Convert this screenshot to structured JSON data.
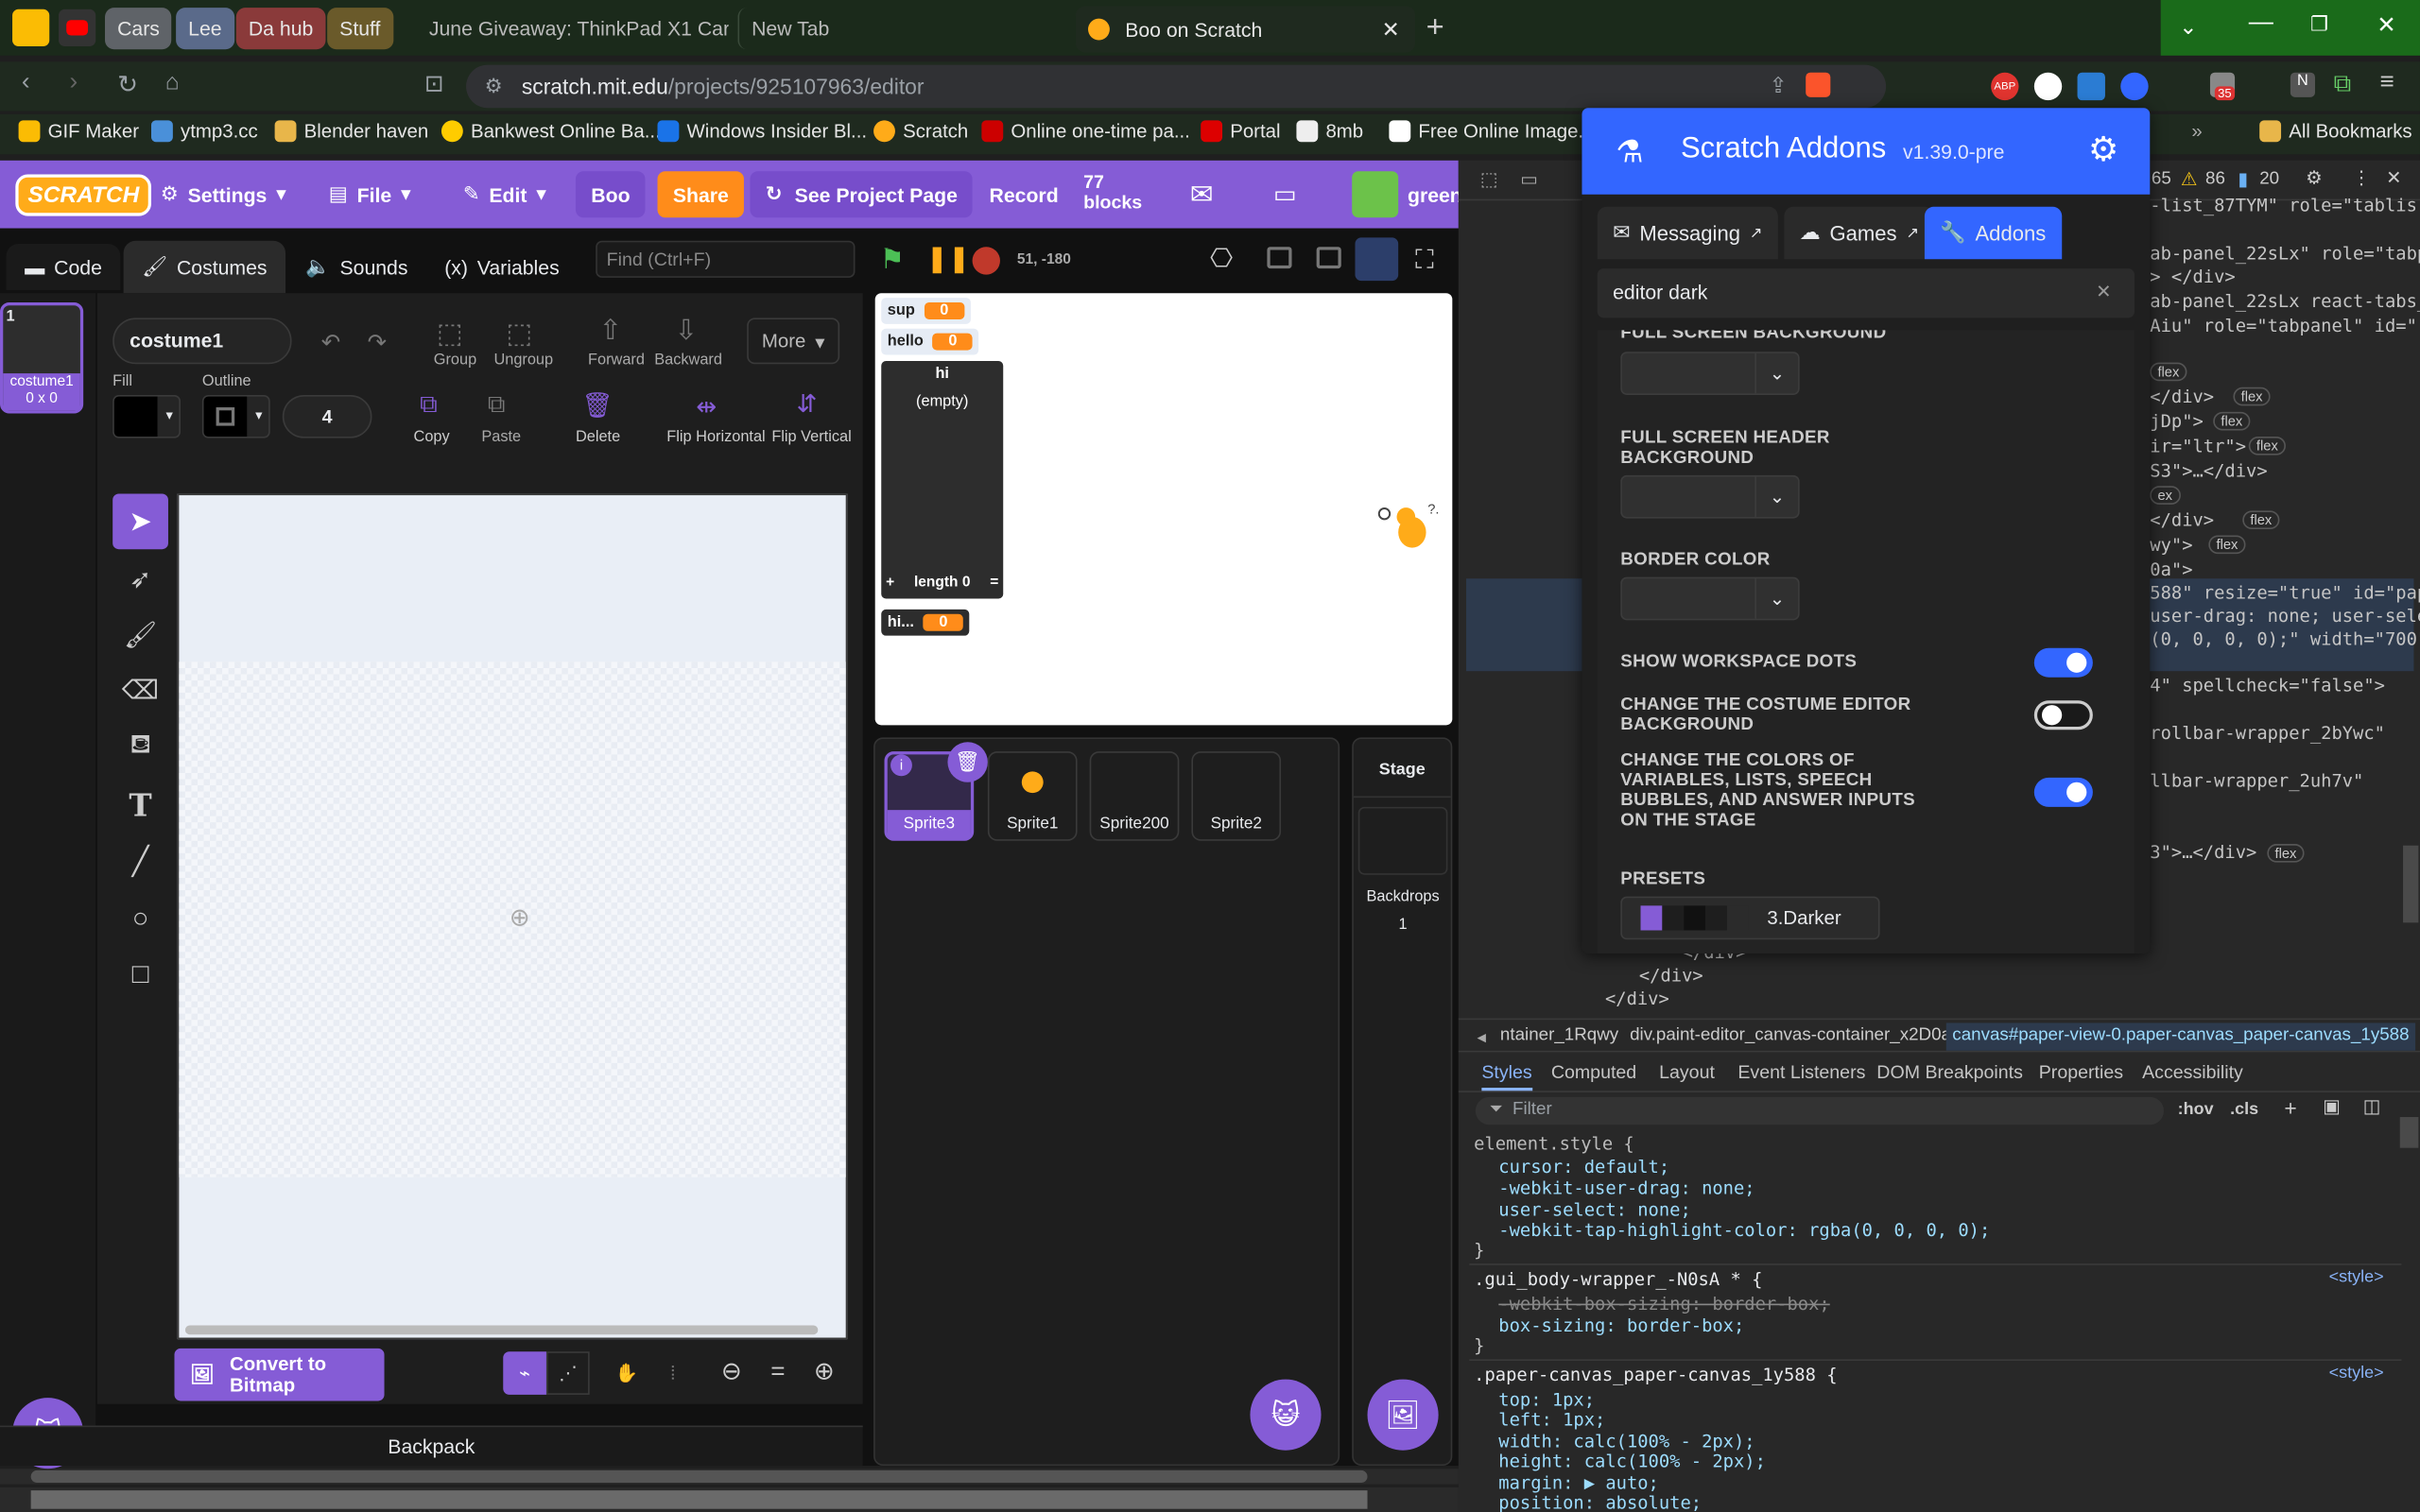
{
  "browser": {
    "tab_groups": [
      "Cars",
      "Lee",
      "Da hub",
      "Stuff"
    ],
    "tabs": [
      {
        "title": "June Giveaway: ThinkPad X1 Carbon"
      },
      {
        "title": "New Tab"
      },
      {
        "title": "Boo on Scratch"
      }
    ],
    "url_host": "scratch.mit.edu",
    "url_path": "/projects/925107963/editor",
    "bookmarks": [
      "GIF Maker",
      "ytmp3.cc",
      "Blender haven",
      "Bankwest Online Ba...",
      "Windows Insider Bl...",
      "Scratch",
      "Online one-time pa...",
      "Portal",
      "8mb",
      "Free Online Image..."
    ],
    "all_bookmarks": "All Bookmarks",
    "ext_badge": "35"
  },
  "scratch": {
    "logo": "SCRATCH",
    "menu": {
      "settings": "Settings",
      "file": "File",
      "edit": "Edit",
      "title": "Boo",
      "share": "Share",
      "see_project_page": "See Project Page",
      "record": "Record",
      "block_count": "77",
      "blocks_word": "blocks",
      "username": "greeny-"
    },
    "tabs": {
      "code": "Code",
      "costumes": "Costumes",
      "sounds": "Sounds",
      "variables": "Variables"
    },
    "find_placeholder": "Find (Ctrl+F)",
    "coords": "51, -180",
    "costume_list": [
      {
        "number": "1",
        "name": "costume1",
        "size": "0 x 0"
      }
    ],
    "paint": {
      "costume_name": "costume1",
      "group": "Group",
      "ungroup": "Ungroup",
      "forward": "Forward",
      "backward": "Backward",
      "more": "More",
      "fill": "Fill",
      "outline": "Outline",
      "outline_width": "4",
      "copy": "Copy",
      "paste": "Paste",
      "delete": "Delete",
      "flip_horizontal": "Flip Horizontal",
      "flip_vertical": "Flip Vertical",
      "convert": "Convert to Bitmap"
    },
    "monitors": [
      {
        "name": "sup",
        "value": "0"
      },
      {
        "name": "hello",
        "value": "0"
      },
      {
        "name": "hi...",
        "value": "0"
      }
    ],
    "list_monitor": {
      "name": "hi",
      "empty": "(empty)",
      "plus": "+",
      "length": "length 0",
      "eq": "="
    },
    "sprites": [
      "Sprite3",
      "Sprite1",
      "Sprite200",
      "Sprite2"
    ],
    "stage_label": "Stage",
    "backdrops_label": "Backdrops",
    "backdrops_count": "1",
    "backpack": "Backpack"
  },
  "addons": {
    "title": "Scratch Addons",
    "version": "v1.39.0-pre",
    "tabs": [
      "Messaging",
      "Games",
      "Addons"
    ],
    "search_value": "editor dark",
    "settings": {
      "fullscreen_bg": "FULL SCREEN BACKGROUND",
      "fullscreen_header_bg": "FULL SCREEN HEADER BACKGROUND",
      "border_color": "BORDER COLOR",
      "show_dots": "SHOW WORKSPACE DOTS",
      "costume_bg": "CHANGE THE COSTUME EDITOR BACKGROUND",
      "var_colors": "CHANGE THE COLORS OF VARIABLES, LISTS, SPEECH BUBBLES, AND ANSWER INPUTS ON THE STAGE",
      "presets": "PRESETS",
      "preset_name": "3.Darker"
    },
    "toggles": {
      "show_dots": true,
      "costume_bg": false,
      "var_colors": true
    },
    "accent": "#3366ff"
  },
  "devtools": {
    "counts": {
      "messages": "65",
      "warnings": "86",
      "issues": "20"
    },
    "breadcrumb": [
      "ntainer_1Rqwy",
      "div.paint-editor_canvas-container_x2D0a",
      "canvas#paper-view-0.paper-canvas_paper-canvas_1y588"
    ],
    "panel_tabs": [
      "Styles",
      "Computed",
      "Layout",
      "Event Listeners",
      "DOM Breakpoints",
      "Properties",
      "Accessibility"
    ],
    "filter_placeholder": "Filter",
    "hov": ":hov",
    "cls": ".cls",
    "dom_lines": [
      "-list_87TYM\" role=\"tablis",
      "ab-panel_22sLx\" role=\"tabp",
      "> </div>",
      "ab-panel_22sLx react-tabs_",
      "Aiu\" role=\"tabpanel\" id=\"r",
      "</div>",
      "jDp\">",
      "ir=\"ltr\">",
      "S3\">…</div>",
      "</div>",
      "wy\">",
      "0a\">",
      "588\" resize=\"true\" id=\"pap",
      "user-drag: none; user-sele",
      "(0, 0, 0, 0);\" width=\"700\"",
      "4\" spellcheck=\"false\">",
      "rollbar-wrapper_2bYwc\"",
      "llbar-wrapper_2uh7v\"",
      "3\">…</div>",
      "</div>",
      "</div>",
      "</div>"
    ],
    "styles": {
      "element_style": "element.style {",
      "rules1": [
        "cursor: default;",
        "-webkit-user-drag: none;",
        "user-select: none;",
        "-webkit-tap-highlight-color: rgba(0, 0, 0, 0);"
      ],
      "close": "}",
      "sel2": ".gui_body-wrapper_-N0sA * {",
      "rules2": [
        "-webkit-box-sizing: border-box;",
        "box-sizing: border-box;"
      ],
      "sel3": ".paper-canvas_paper-canvas_1y588 {",
      "rules3": [
        "top: 1px;",
        "left: 1px;",
        "width: calc(100% - 2px);",
        "height: calc(100% - 2px);",
        "margin: ▶ auto;",
        "position: absolute;"
      ],
      "source": "<style>"
    }
  }
}
